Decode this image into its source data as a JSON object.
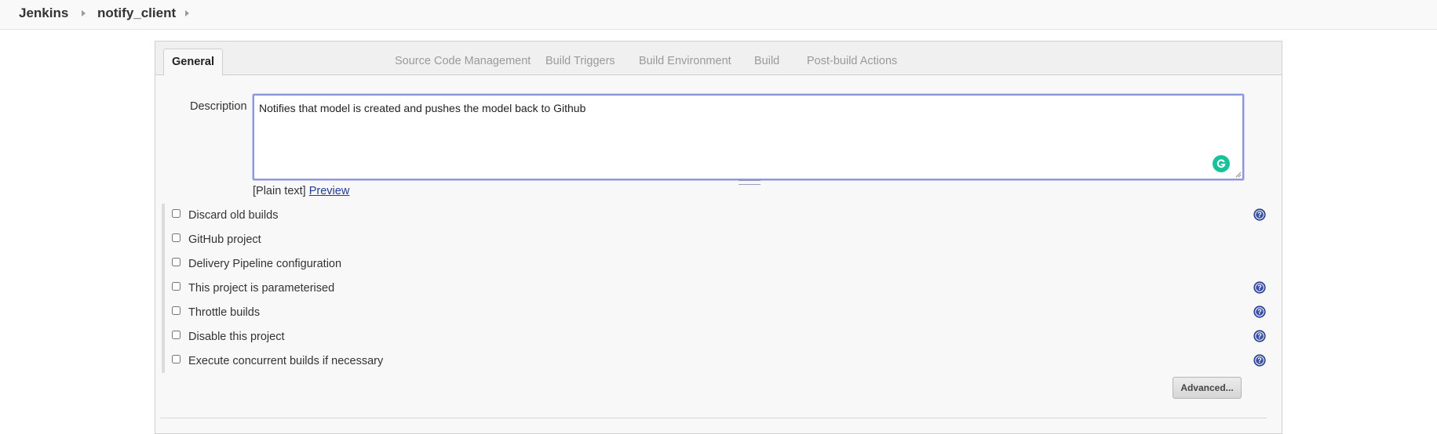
{
  "breadcrumb": {
    "root": "Jenkins",
    "job": "notify_client"
  },
  "tabs": [
    {
      "label": "General",
      "active": true
    },
    {
      "label": "Source Code Management",
      "active": false
    },
    {
      "label": "Build Triggers",
      "active": false
    },
    {
      "label": "Build Environment",
      "active": false
    },
    {
      "label": "Build",
      "active": false
    },
    {
      "label": "Post-build Actions",
      "active": false
    }
  ],
  "description": {
    "label": "Description",
    "value": "Notifies that model is created and pushes the model back to Github",
    "format_prefix": "[Plain text]",
    "preview_link": "Preview"
  },
  "options": [
    {
      "label": "Discard old builds",
      "checked": false,
      "help": true
    },
    {
      "label": "GitHub project",
      "checked": false,
      "help": false
    },
    {
      "label": "Delivery Pipeline configuration",
      "checked": false,
      "help": false
    },
    {
      "label": "This project is parameterised",
      "checked": false,
      "help": true
    },
    {
      "label": "Throttle builds",
      "checked": false,
      "help": true
    },
    {
      "label": "Disable this project",
      "checked": false,
      "help": true
    },
    {
      "label": "Execute concurrent builds if necessary",
      "checked": false,
      "help": true
    }
  ],
  "advanced_button": "Advanced...",
  "colors": {
    "accent_border": "#8c96d8",
    "help_icon": "#3a52a6",
    "grammarly": "#15c39a",
    "link": "#1f3a93"
  },
  "icons": {
    "help": "help-icon",
    "grammarly": "grammarly-icon",
    "breadcrumb_separator": "chevron-right-icon"
  }
}
